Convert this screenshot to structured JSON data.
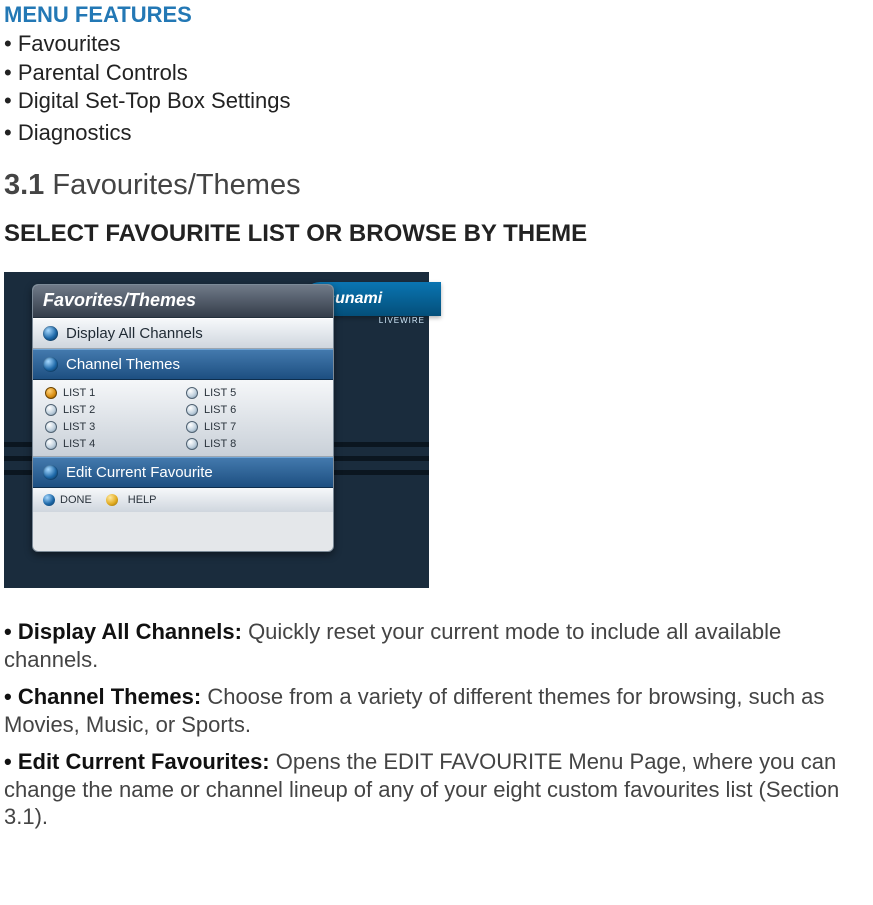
{
  "menu_header": "MENU FEATURES",
  "menu_items": [
    "Favourites",
    "Parental Controls",
    "Digital Set-Top Box Settings",
    "Diagnostics"
  ],
  "section_number": "3.1",
  "section_title": "Favourites/Themes",
  "sub_title": "SELECT FAVOURITE LIST OR BROWSE BY THEME",
  "ui": {
    "logo": "Tsunami",
    "logo_sub": "LIVEWIRE",
    "panel_title": "Favorites/Themes",
    "row_display_all": "Display All Channels",
    "row_channel_themes": "Channel Themes",
    "lists_left": [
      "LIST 1",
      "LIST 2",
      "LIST 3",
      "LIST 4"
    ],
    "lists_right": [
      "LIST 5",
      "LIST 6",
      "LIST 7",
      "LIST 8"
    ],
    "row_edit": "Edit Current Favourite",
    "footer_done": "DONE",
    "footer_help": "HELP"
  },
  "descriptions": [
    {
      "title": "Display All Channels:",
      "body": " Quickly reset your current mode to include all available channels."
    },
    {
      "title": "Channel Themes:",
      "body": " Choose from a variety of different themes for browsing, such as Movies, Music, or Sports."
    },
    {
      "title": "Edit Current Favourites:",
      "body": " Opens the EDIT FAVOURITE Menu Page, where you can change the name or channel lineup of any of your eight custom favourites list (Section 3.1)."
    }
  ]
}
